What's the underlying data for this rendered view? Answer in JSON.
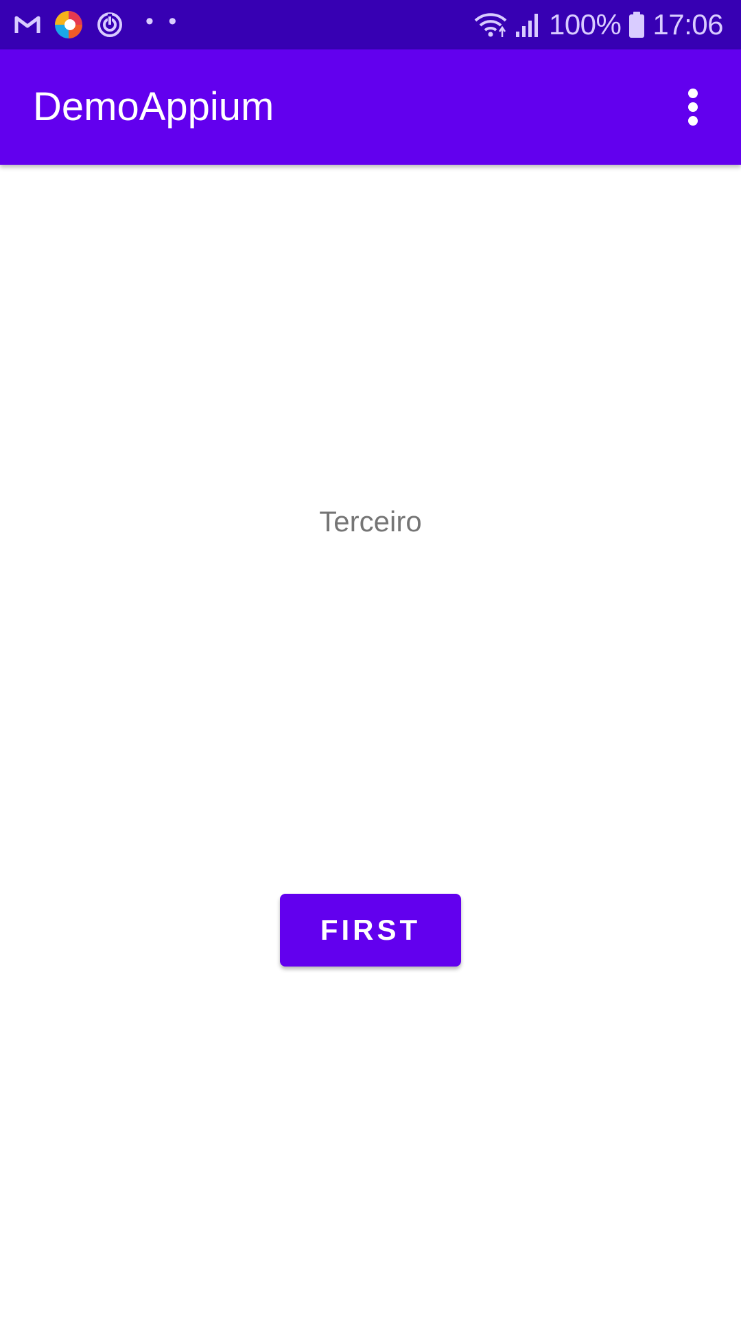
{
  "status_bar": {
    "battery": "100%",
    "time": "17:06",
    "more_indicator": "• •",
    "left_icons": [
      "gmail-icon",
      "browser-icon",
      "sync-icon"
    ],
    "right_icons": [
      "wifi-icon",
      "signal-icon",
      "battery-icon"
    ],
    "colors": {
      "background": "#3700b3",
      "foreground": "#d9ccff"
    }
  },
  "app_bar": {
    "title": "DemoAppium",
    "overflow_icon": "more-vert-icon",
    "colors": {
      "background": "#6200ee",
      "foreground": "#ffffff"
    }
  },
  "content": {
    "fragment_text": "Terceiro",
    "button_label": "FIRST",
    "colors": {
      "text": "#757575",
      "button": "#6200ee"
    }
  }
}
